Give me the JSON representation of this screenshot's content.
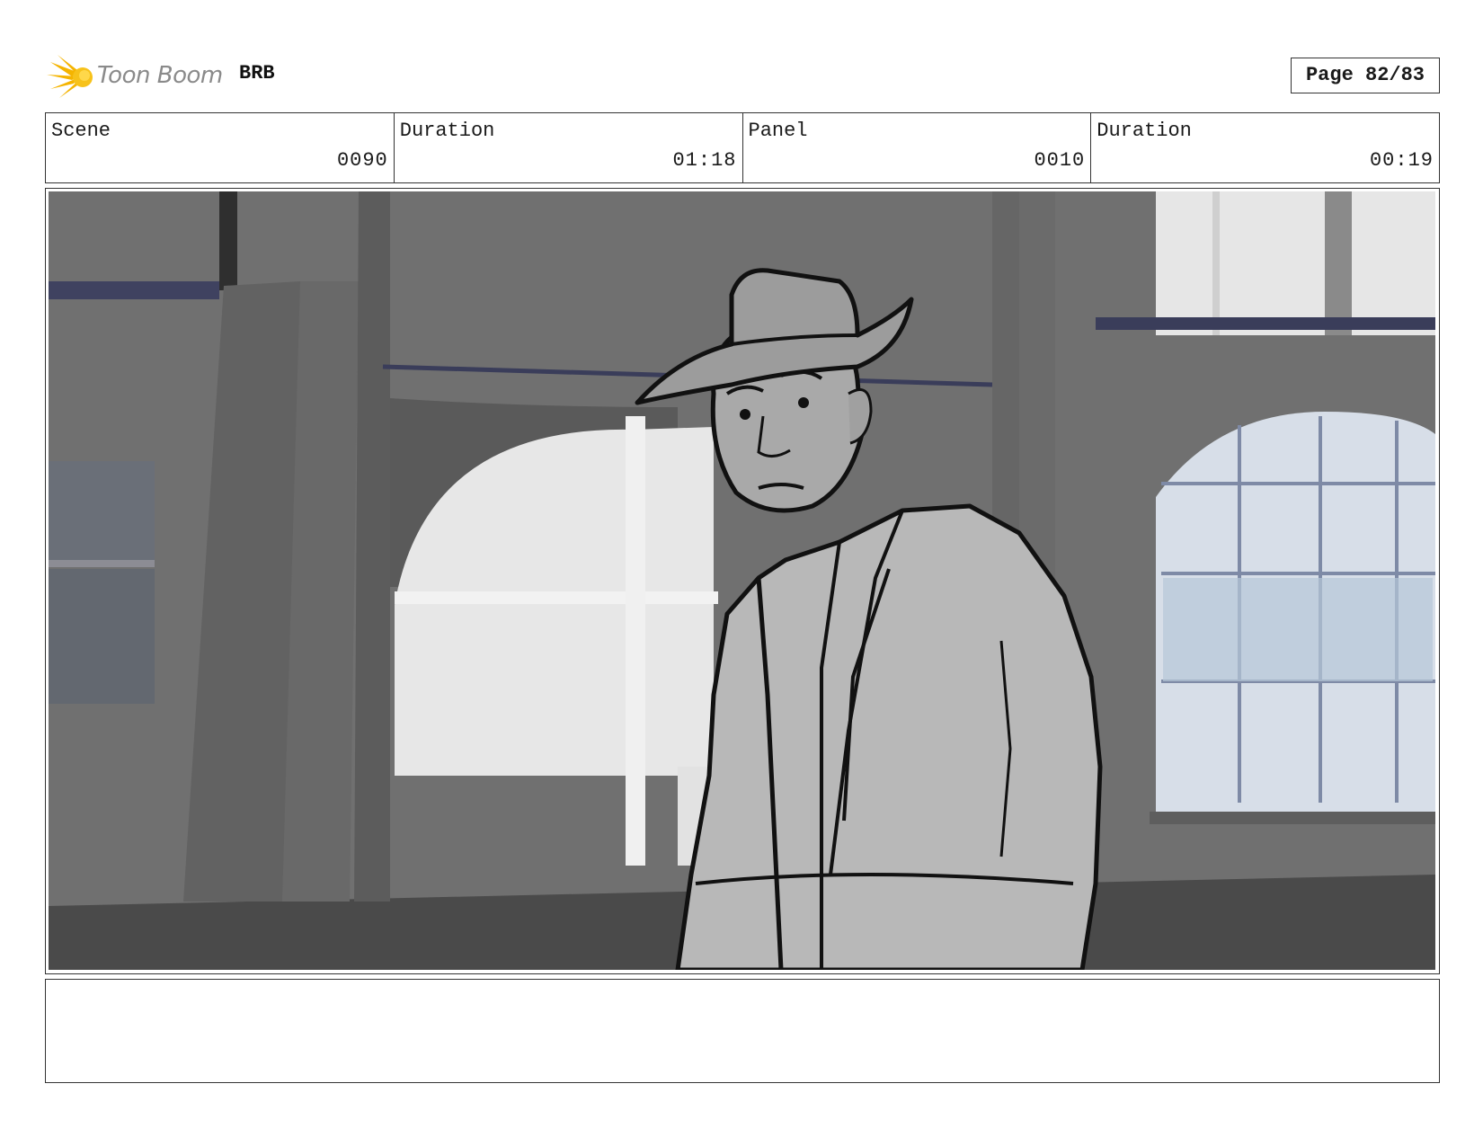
{
  "header": {
    "logo_text": "Toon Boom",
    "logo_icon": "toon-boom-starburst-icon",
    "project": "BRB",
    "page": "Page 82/83"
  },
  "info": {
    "scene_label": "Scene",
    "scene_value": "0090",
    "scene_duration_label": "Duration",
    "scene_duration_value": "01:18",
    "panel_label": "Panel",
    "panel_value": "0010",
    "panel_duration_label": "Duration",
    "panel_duration_value": "00:19"
  },
  "colors": {
    "accent": "#f5b400",
    "border": "#333333"
  },
  "notes": {
    "text": ""
  }
}
